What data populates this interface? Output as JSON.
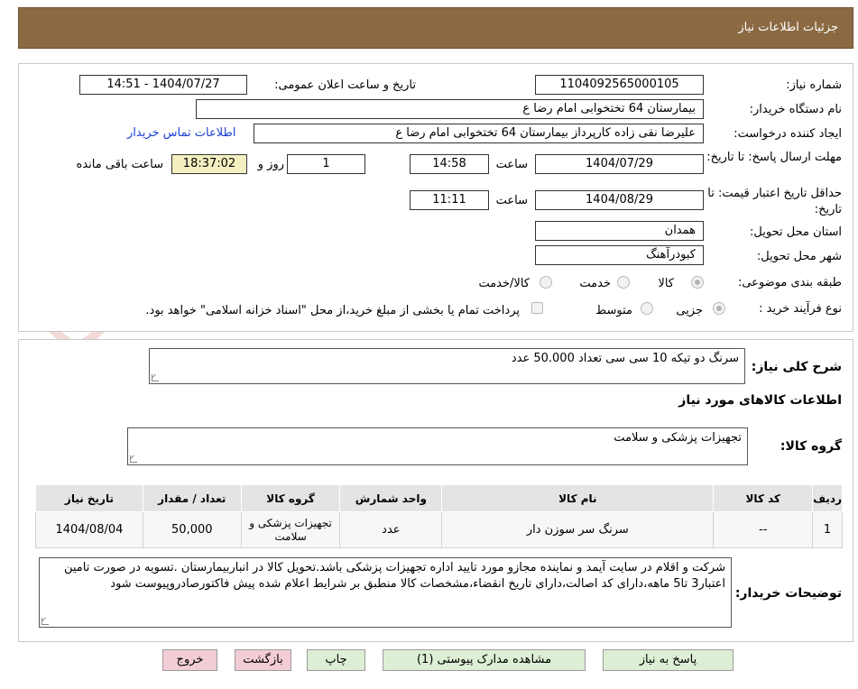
{
  "header": {
    "title": "جزئیات اطلاعات نیاز"
  },
  "form": {
    "need_number_label": "شماره نیاز:",
    "need_number": "1104092565000105",
    "announce_label": "تاریخ و ساعت اعلان عمومی:",
    "announce_value": "1404/07/27 - 14:51",
    "buyer_org_label": "نام دستگاه خریدار:",
    "buyer_org": "بیمارستان  64 تختخوابی امام رضا   ع",
    "requester_label": "ایجاد کننده درخواست:",
    "requester": "علیرضا نقی زاده کارپرداز بیمارستان  64 تختخوابی امام رضا   ع",
    "contact_link": "اطلاعات تماس خریدار",
    "deadline_label": "مهلت ارسال پاسخ: تا تاریخ:",
    "deadline_date": "1404/07/29",
    "time_label": "ساعت",
    "deadline_time": "14:58",
    "days_value": "1",
    "days_label": "روز و",
    "remaining_time": "18:37:02",
    "remaining_label": "ساعت باقی مانده",
    "validity_label": "حداقل تاریخ اعتبار قیمت: تا تاریخ:",
    "validity_date": "1404/08/29",
    "validity_time": "11:11",
    "province_label": "استان محل تحویل:",
    "province": "همدان",
    "city_label": "شهر محل تحویل:",
    "city": "کبودرآهنگ",
    "category_label": "طبقه بندی موضوعی:",
    "category_options": [
      "کالا",
      "خدمت",
      "کالا/خدمت"
    ],
    "process_label": "نوع فرآیند خرید :",
    "process_options": [
      "جزیی",
      "متوسط"
    ],
    "payment_note": "پرداخت تمام یا بخشی از مبلغ خرید،از محل \"اسناد خزانه اسلامی\" خواهد بود."
  },
  "need": {
    "summary_label": "شرح کلی نیاز:",
    "summary": "سرنگ دو تیکه 10 سی سی تعداد 50.000 عدد",
    "items_title": "اطلاعات کالاهای مورد نیاز",
    "group_label": "گروه کالا:",
    "group": "تجهیزات پزشکی و سلامت"
  },
  "table": {
    "headers": [
      "ردیف",
      "کد کالا",
      "نام کالا",
      "واحد شمارش",
      "گروه کالا",
      "تعداد / مقدار",
      "تاریخ نیاز"
    ],
    "rows": [
      [
        "1",
        "--",
        "سرنگ سر سوزن دار",
        "عدد",
        "تجهیزات پزشکی و سلامت",
        "50,000",
        "1404/08/04"
      ]
    ]
  },
  "notes": {
    "label": "توضیحات خریدار:",
    "text": "شرکت و اقلام در سایت آیمد و نماینده مجازو مورد تایید اداره تجهیزات پزشکی باشد.تحویل کالا در انباربیمارستان .تسویه در صورت تامین اعتبار3 تا5 ماهه،دارای کد اصالت،دارای تاریخ انقضاء،مشخصات کالا منطبق بر شرایط اعلام شده پیش فاکتورصادروپیوست شود"
  },
  "buttons": {
    "reply": "پاسخ به نیاز",
    "attachments": "مشاهده مدارک پیوستی (1)",
    "print": "چاپ",
    "back": "بازگشت",
    "exit": "خروج"
  },
  "watermark": {
    "text": "AriaTender.neT"
  }
}
